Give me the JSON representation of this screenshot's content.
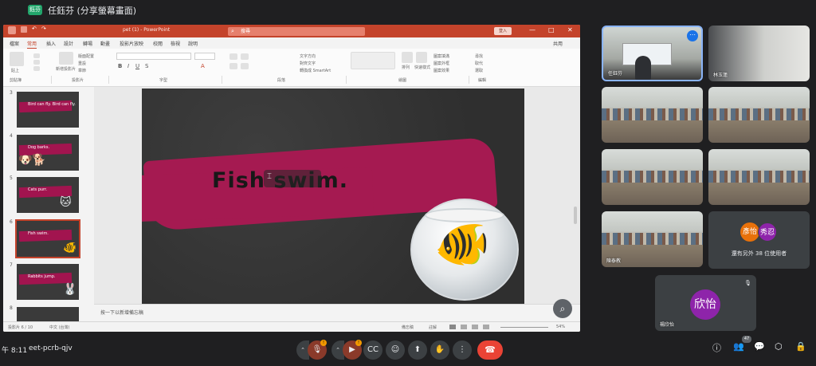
{
  "presenter": {
    "badge": "鈺芬",
    "title": "任鈺芬 (分享螢幕畫面)"
  },
  "ppt": {
    "file_name": "pet (1) - PowerPoint",
    "search_placeholder": "搜尋",
    "signin": "登入",
    "tabs": [
      "檔案",
      "常用",
      "插入",
      "設計",
      "轉場",
      "動畫",
      "投影片放映",
      "校閱",
      "檢視",
      "說明"
    ],
    "active_tab": "常用",
    "share": "共用",
    "ribbon_groups": [
      "剪貼簿",
      "投影片",
      "字型",
      "段落",
      "繪圖",
      "編輯"
    ],
    "ribbon_buttons": {
      "paste": "貼上",
      "new_slide": "新增投影片",
      "layout": "版面配置",
      "reset": "重設",
      "section": "章節",
      "arrange": "排列",
      "quick_styles": "快速樣式",
      "shape_fill": "圖案填滿",
      "shape_outline": "圖案外框",
      "shape_effects": "圖案效果",
      "find": "尋找",
      "replace": "取代",
      "select": "選取",
      "text_direction": "文字方向",
      "align_text": "對齊文字",
      "smartart": "轉換成 SmartArt"
    },
    "notes_placeholder": "按一下以新增備忘稿",
    "status": {
      "slide_pos": "投影片 6 / 10",
      "language": "中文 (台灣)",
      "notes": "備忘稿",
      "comments": "註解",
      "zoom": "54%"
    },
    "thumbnails": [
      {
        "num": "3",
        "text": "Bird can fly. Bird can fly.",
        "icon": ""
      },
      {
        "num": "4",
        "text": "Dog barks.",
        "icon": "🐶🐕"
      },
      {
        "num": "5",
        "text": "Cats purr.",
        "icon": "🐱"
      },
      {
        "num": "6",
        "text": "Fish swim.",
        "icon": "🐠"
      },
      {
        "num": "7",
        "text": "Rabbits jump.",
        "icon": "🐰"
      },
      {
        "num": "8",
        "text": "",
        "icon": ""
      }
    ],
    "slide_text": "Fish swim."
  },
  "participants": [
    {
      "name": "任鈺芬"
    },
    {
      "name": "林玉蓮"
    },
    {
      "name": ""
    },
    {
      "name": ""
    },
    {
      "name": ""
    },
    {
      "name": ""
    },
    {
      "name": "陳泰教"
    },
    {
      "name": ""
    }
  ],
  "others_tile": {
    "avatar_a": "彥怡",
    "avatar_b": "秀忍",
    "text": "還有另外 38 位使用者"
  },
  "self_tile": {
    "avatar": "欣怡",
    "name": "楊欣怡"
  },
  "bottom": {
    "clock": "午 8:11",
    "meeting_code": "eet-pcrb-qjv",
    "people_count": "47"
  },
  "colors": {
    "ppt_accent": "#c4432b",
    "slide_brush": "#a51a51",
    "end_call": "#ea4335",
    "meet_blue": "#1a73e8"
  }
}
